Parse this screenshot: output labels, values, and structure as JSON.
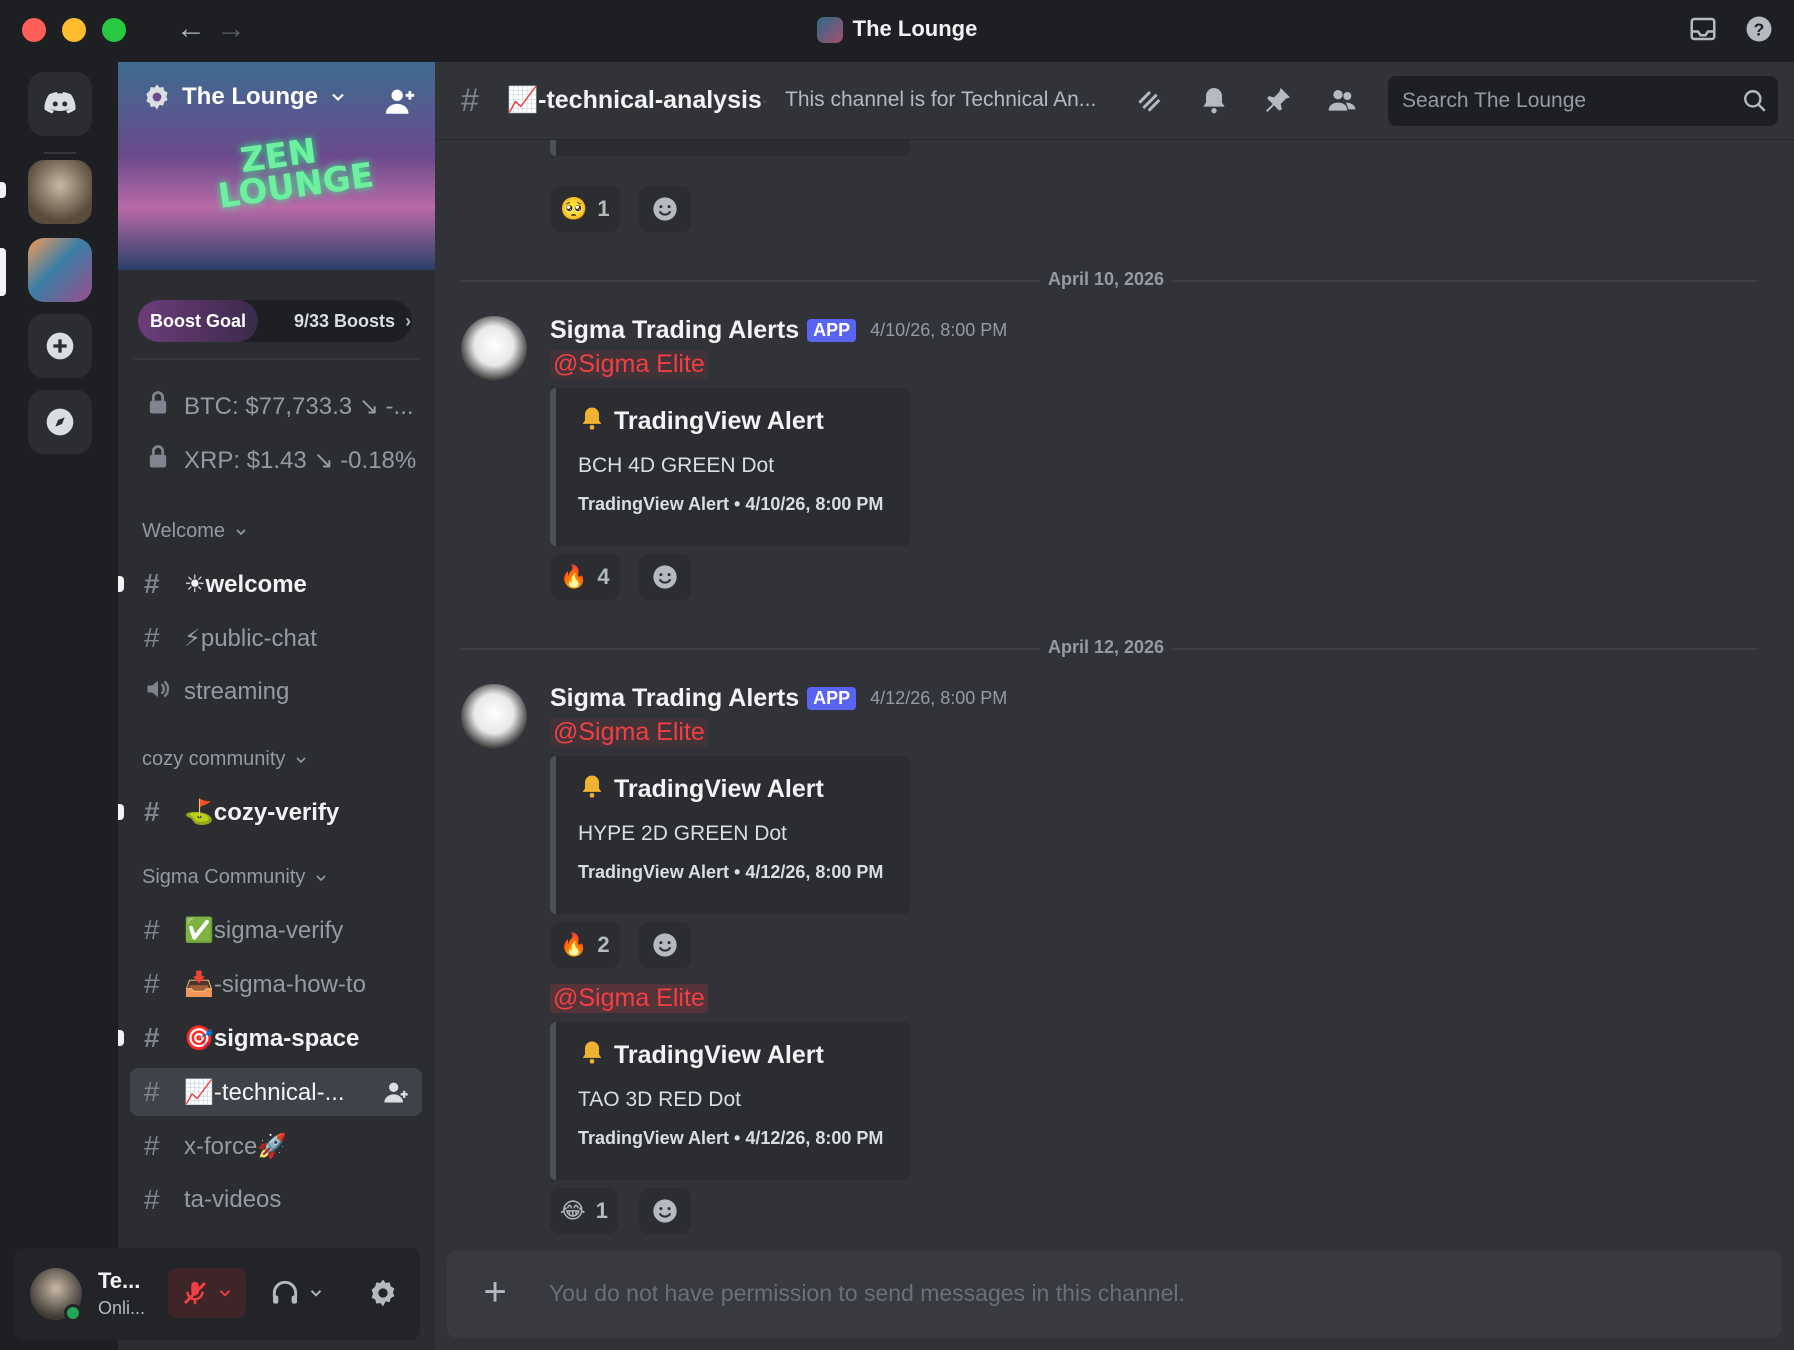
{
  "window": {
    "title": "The Lounge",
    "back_label": "←",
    "forward_label": "→"
  },
  "server": {
    "name": "The Lounge",
    "banner_text": "ZEN LOUNGE",
    "boost": {
      "label": "Boost Goal",
      "count": "9/33 Boosts",
      "chevron": "›"
    }
  },
  "sidebar": {
    "locked_channels": [
      {
        "name": "BTC: $77,733.3 ↘ -..."
      },
      {
        "name": "XRP: $1.43 ↘ -0.18%"
      }
    ],
    "categories": [
      {
        "name": "Welcome"
      },
      {
        "name": "cozy community"
      },
      {
        "name": "Sigma Community"
      }
    ],
    "channels": [
      {
        "name": "☀welcome",
        "type": "text",
        "unread": true
      },
      {
        "name": "⚡public-chat",
        "type": "text",
        "unread": false
      },
      {
        "name": "streaming",
        "type": "voice",
        "unread": false
      },
      {
        "name": "⛳cozy-verify",
        "type": "text",
        "unread": true
      },
      {
        "name": "✅sigma-verify",
        "type": "text",
        "unread": false
      },
      {
        "name": "📥-sigma-how-to",
        "type": "text-locked",
        "unread": false
      },
      {
        "name": "🎯sigma-space",
        "type": "text-locked",
        "unread": true
      },
      {
        "name": "📈-technical-...",
        "type": "text-locked",
        "active": true
      },
      {
        "name": "x-force🚀",
        "type": "text-locked",
        "unread": false
      },
      {
        "name": "ta-videos",
        "type": "text-locked",
        "unread": false
      }
    ]
  },
  "user": {
    "name": "Te...",
    "status": "Onli..."
  },
  "channel_header": {
    "hash": "#",
    "name": "📈-technical-analysis",
    "separator": "·",
    "topic": "This channel is for Technical An...",
    "search_placeholder": "Search The Lounge"
  },
  "messages": {
    "top_reaction": {
      "emoji": "🥺",
      "count": "1"
    },
    "dates": [
      "April 10, 2026",
      "April 12, 2026"
    ],
    "groups": [
      {
        "author": "Sigma Trading Alerts",
        "badge": "APP",
        "timestamp": "4/10/26, 8:00 PM",
        "items": [
          {
            "mention": "@Sigma Elite",
            "embed_title": "TradingView Alert",
            "embed_desc": "BCH 4D GREEN Dot",
            "embed_footer": "TradingView Alert • 4/10/26, 8:00 PM",
            "reaction": {
              "emoji": "🔥",
              "count": "4"
            }
          }
        ]
      },
      {
        "author": "Sigma Trading Alerts",
        "badge": "APP",
        "timestamp": "4/12/26, 8:00 PM",
        "items": [
          {
            "mention": "@Sigma Elite",
            "embed_title": "TradingView Alert",
            "embed_desc": "HYPE 2D GREEN Dot",
            "embed_footer": "TradingView Alert • 4/12/26, 8:00 PM",
            "reaction": {
              "emoji": "🔥",
              "count": "2"
            }
          },
          {
            "mention": "@Sigma Elite",
            "embed_title": "TradingView Alert",
            "embed_desc": "TAO 3D RED Dot",
            "embed_footer": "TradingView Alert • 4/12/26, 8:00 PM",
            "reaction": {
              "emoji": "😂",
              "count": "1"
            }
          }
        ]
      }
    ]
  },
  "composer": {
    "plus": "+",
    "placeholder": "You do not have permission to send messages in this channel."
  },
  "colors": {
    "accent": "#5865f2",
    "mention": "#f23f43",
    "online": "#23a55a",
    "bell": "#f0b232"
  }
}
